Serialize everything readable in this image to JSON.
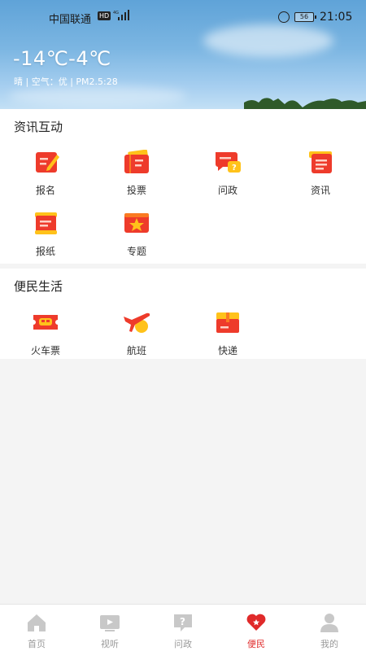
{
  "status_bar": {
    "carrier": "中国联通",
    "hd": "HD",
    "battery": "56",
    "time": "21:05"
  },
  "weather": {
    "temperature": "-14℃-4℃",
    "detail": "晴 | 空气：优 | PM2.5:28"
  },
  "sections": [
    {
      "title": "资讯互动",
      "items": [
        {
          "label": "报名",
          "icon": "signup-icon"
        },
        {
          "label": "投票",
          "icon": "vote-icon"
        },
        {
          "label": "问政",
          "icon": "inquiry-icon"
        },
        {
          "label": "资讯",
          "icon": "news-icon"
        },
        {
          "label": "报纸",
          "icon": "newspaper-icon"
        },
        {
          "label": "专题",
          "icon": "topic-icon"
        }
      ]
    },
    {
      "title": "便民生活",
      "items": [
        {
          "label": "火车票",
          "icon": "train-ticket-icon"
        },
        {
          "label": "航班",
          "icon": "flight-icon"
        },
        {
          "label": "快递",
          "icon": "parcel-icon"
        }
      ]
    }
  ],
  "tabbar": {
    "active": 3,
    "tabs": [
      {
        "label": "首页",
        "icon": "home-icon"
      },
      {
        "label": "视听",
        "icon": "video-icon"
      },
      {
        "label": "问政",
        "icon": "inquiry-icon"
      },
      {
        "label": "便民",
        "icon": "heart-icon"
      },
      {
        "label": "我的",
        "icon": "user-icon"
      }
    ]
  },
  "colors": {
    "accent": "#e02a2a",
    "icon_red": "#ee3b2b",
    "icon_orange": "#fa7a22",
    "icon_yellow": "#ffc21a",
    "tab_inactive": "#9a9a9a"
  }
}
